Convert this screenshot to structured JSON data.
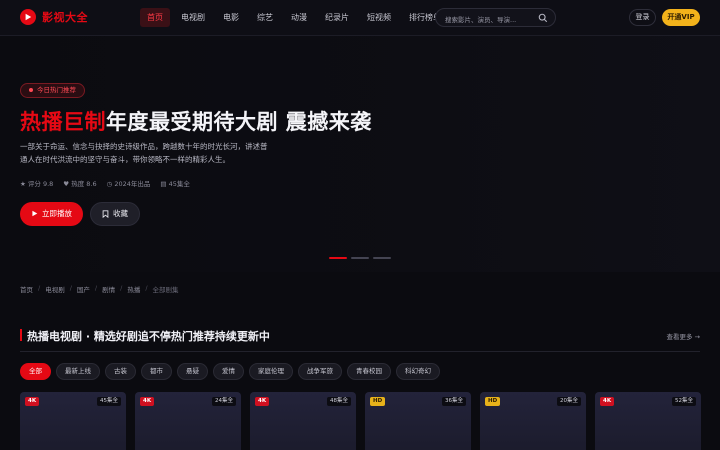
{
  "header": {
    "logo_text": "影视大全",
    "nav": [
      "首页",
      "电视剧",
      "电影",
      "综艺",
      "动漫",
      "纪录片",
      "短视频",
      "排行榜单"
    ],
    "search_placeholder": "搜索影片、演员、导演...",
    "login_label": "登录",
    "vip_label": "开通VIP"
  },
  "hero": {
    "badge": "今日热门推荐",
    "title_red": "热播巨制",
    "title_rest": "年度最受期待大剧 震撼来袭",
    "desc": "一部关于命运、信念与抉择的史诗级作品，跨越数十年的时光长河，讲述普通人在时代洪流中的坚守与奋斗，带你领略不一样的精彩人生。",
    "meta": [
      "★ 评分 9.8",
      "♥ 热度 8.6",
      "◷ 2024年出品",
      "▤ 45集全"
    ],
    "play_label": "立即播放",
    "fav_label": "收藏",
    "slides": 3,
    "active_slide": 0
  },
  "breadcrumb": [
    "首页",
    "电视剧",
    "国产",
    "剧情",
    "热播",
    "全部剧集"
  ],
  "section": {
    "title": "热播电视剧 · 精选好剧追不停热门推荐持续更新中",
    "more": "查看更多 →",
    "filters": [
      "全部",
      "最新上线",
      "古装",
      "都市",
      "悬疑",
      "爱情",
      "家庭伦理",
      "战争军旅",
      "青春校园",
      "科幻奇幻"
    ],
    "active_filter": 0
  },
  "cards": [
    {
      "quality": "4K",
      "episodes": "45集全"
    },
    {
      "quality": "4K",
      "episodes": "24集全"
    },
    {
      "quality": "4K",
      "episodes": "48集全"
    },
    {
      "quality": "HD",
      "episodes": "36集全"
    },
    {
      "quality": "HD",
      "episodes": "20集全"
    },
    {
      "quality": "4K",
      "episodes": "52集全"
    }
  ],
  "colors": {
    "accent": "#e50914",
    "vip": "#f2b21b",
    "background": "#0b0b10"
  }
}
